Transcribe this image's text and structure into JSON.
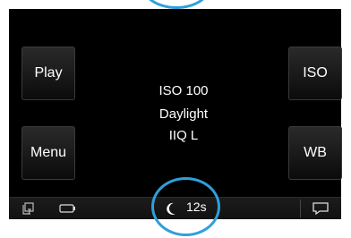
{
  "buttons": {
    "play": "Play",
    "menu": "Menu",
    "iso": "ISO",
    "wb": "WB"
  },
  "info": {
    "iso": "ISO 100",
    "white_balance": "Daylight",
    "format": "IIQ L"
  },
  "status": {
    "timer_label": "12s",
    "icons": [
      "cards-icon",
      "battery-icon",
      "moon-icon",
      "chat-icon"
    ]
  },
  "colors": {
    "highlight_ring": "#2f9fdb",
    "screen": "#000000"
  }
}
